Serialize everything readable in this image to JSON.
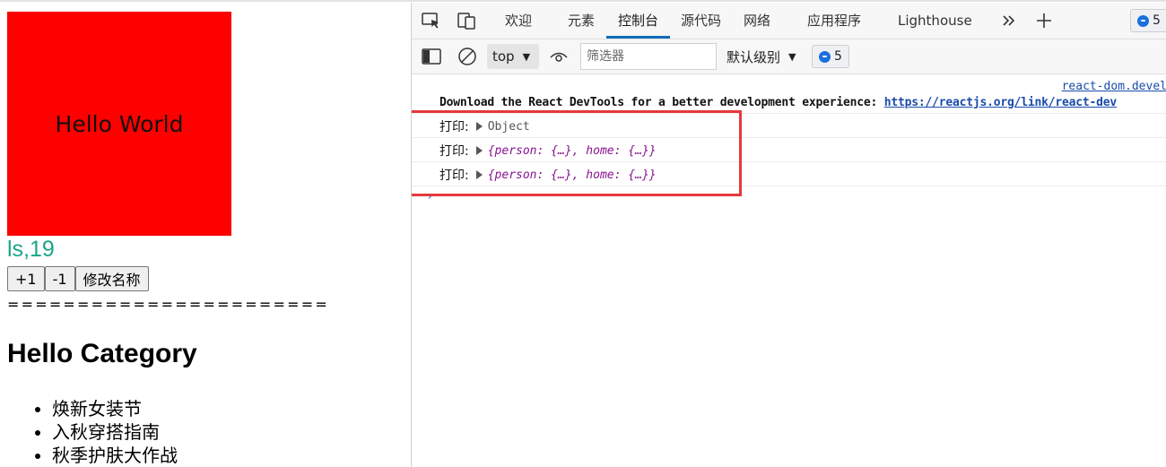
{
  "page": {
    "box_text": "Hello World",
    "name_age": "ls,19",
    "buttons": {
      "inc": "+1",
      "dec": "-1",
      "rename": "修改名称"
    },
    "divider": "=======================",
    "heading": "Hello Category",
    "categories": [
      "焕新女装节",
      "入秋穿搭指南",
      "秋季护肤大作战"
    ]
  },
  "devtools": {
    "tabs": [
      "欢迎",
      "元素",
      "控制台",
      "源代码",
      "网络",
      "应用程序",
      "Lighthouse"
    ],
    "active_tab": "控制台",
    "more_tabs_icon": "chevron-double-right",
    "add_tab_icon": "plus",
    "message_count": "5",
    "toolbar": {
      "context": "top",
      "filter_placeholder": "筛选器",
      "level": "默认级别",
      "issues_count": "5"
    },
    "console": {
      "source_link": "react-dom.devel",
      "download_text": "Download the React DevTools for a better development experience: ",
      "download_link": "https://reactjs.org/link/react-dev",
      "logs": [
        {
          "label": "打印:",
          "value": "Object"
        },
        {
          "label": "打印:",
          "value": "{person: {…}, home: {…}}"
        },
        {
          "label": "打印:",
          "value": "{person: {…}, home: {…}}"
        }
      ],
      "prompt": "›"
    },
    "colors": {
      "accent": "#0f6cbd",
      "highlight": "#e5393f",
      "link": "#1a4cab",
      "badge": "#1b6fe0"
    }
  }
}
